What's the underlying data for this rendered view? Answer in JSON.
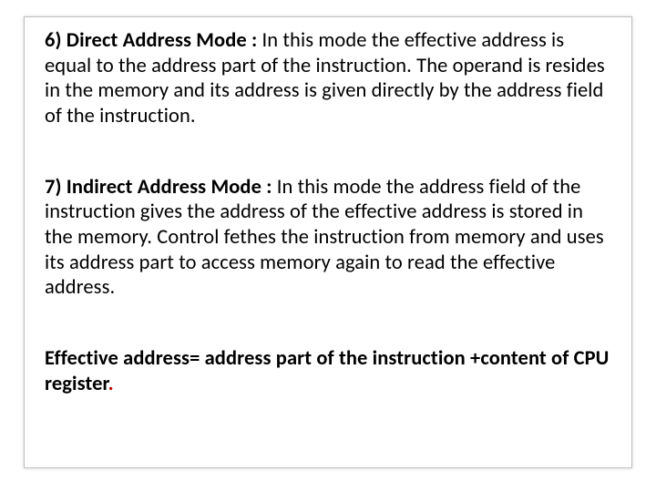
{
  "sections": {
    "s6": {
      "title": "6) Direct Address Mode : ",
      "body": "In this mode the effective address is equal to the address part of the instruction. The operand is resides in the memory and its address is given directly by the address field of the instruction."
    },
    "s7": {
      "title": "7) Indirect Address Mode : ",
      "body": "In this mode the address field of the instruction gives the address of the effective address is stored in the memory.  Control fethes  the instruction from memory and uses its address part to access memory again to read the effective address."
    },
    "formula": {
      "text": "Effective address= address part of the instruction +content of CPU register",
      "dot": "."
    }
  }
}
